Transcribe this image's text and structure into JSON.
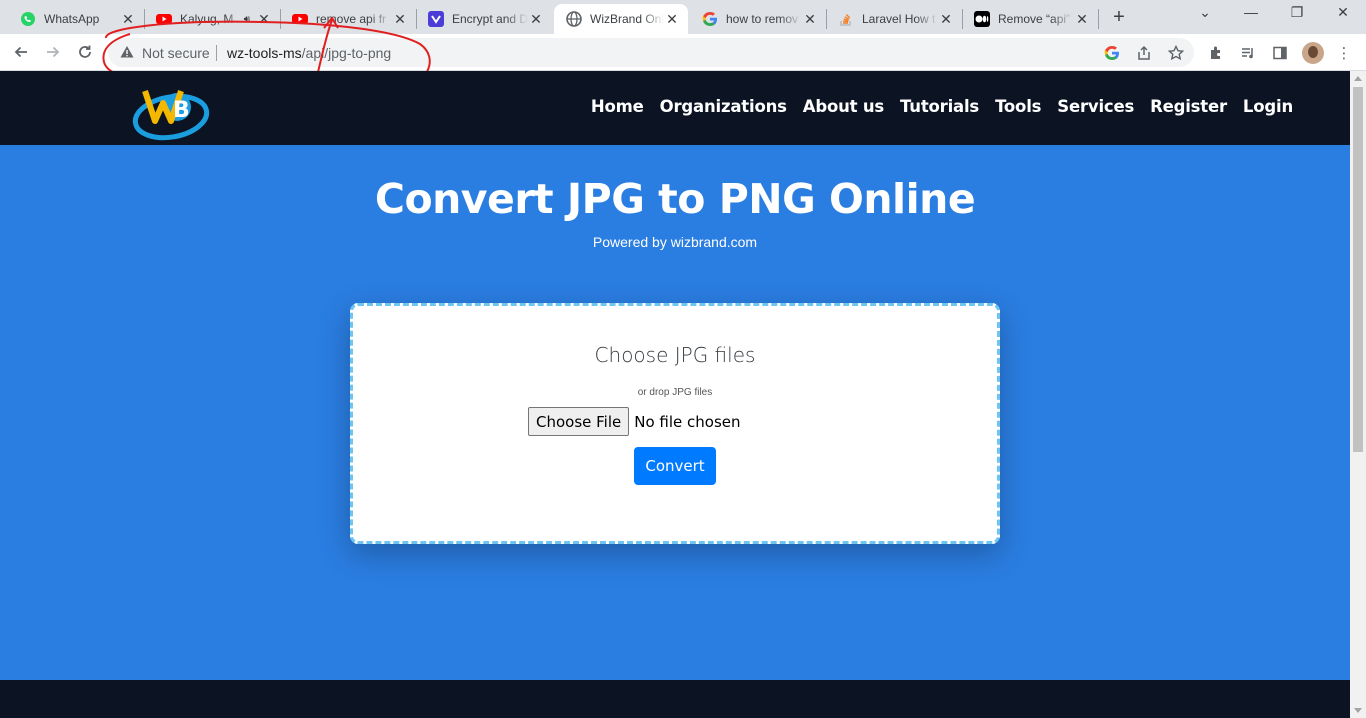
{
  "browser": {
    "tabs": [
      {
        "title": "WhatsApp",
        "icon": "whatsapp-icon",
        "color": "#25d366"
      },
      {
        "title": "Kalyug, M",
        "icon": "youtube-icon",
        "color": "#ff0000",
        "audio": true
      },
      {
        "title": "remove api fr",
        "icon": "youtube-icon",
        "color": "#ff0000"
      },
      {
        "title": "Encrypt and D",
        "icon": "app-icon",
        "color": "#4c3cd8"
      },
      {
        "title": "WizBrand Onl",
        "icon": "globe-icon",
        "color": "#5f6368",
        "active": true
      },
      {
        "title": "how to remov",
        "icon": "google-icon",
        "color": "#4285f4"
      },
      {
        "title": "Laravel How t",
        "icon": "stackoverflow-icon",
        "color": "#f48024"
      },
      {
        "title": "Remove “api”",
        "icon": "medium-icon",
        "color": "#000000"
      }
    ],
    "security_label": "Not secure",
    "url_host": "wz-tools-ms",
    "url_path": "/api/jpg-to-png"
  },
  "site": {
    "nav": [
      "Home",
      "Organizations",
      "About us",
      "Tutorials",
      "Tools",
      "Services",
      "Register",
      "Login"
    ],
    "hero_title": "Convert JPG to PNG Online",
    "hero_subtitle": "Powered by wizbrand.com",
    "upload": {
      "title": "Choose JPG files",
      "subtitle": "or drop JPG files",
      "file_button": "Choose File",
      "file_status": "No file chosen",
      "convert_button": "Convert"
    },
    "colors": {
      "page_bg": "#2a7de1",
      "nav_bg": "#0c1424",
      "button": "#007bff",
      "dropzone_border": "#6ec6f0"
    }
  }
}
